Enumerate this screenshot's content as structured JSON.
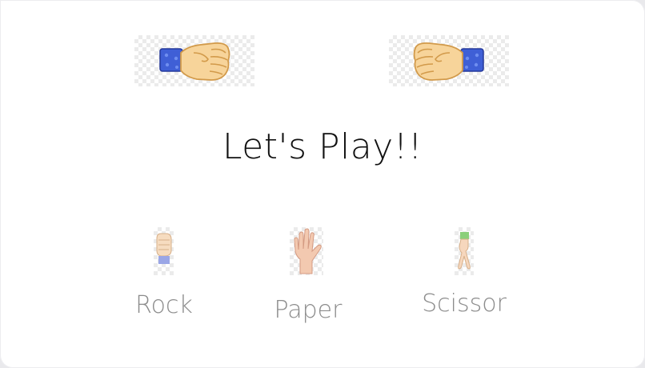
{
  "game": {
    "status_text": "Let's Play!!",
    "player_hand": "fist-icon",
    "computer_hand": "fist-icon"
  },
  "choices": [
    {
      "label": "Rock",
      "icon": "rock-hand-icon"
    },
    {
      "label": "Paper",
      "icon": "paper-hand-icon"
    },
    {
      "label": "Scissor",
      "icon": "scissor-hand-icon"
    }
  ],
  "colors": {
    "sleeve": "#3f5fd6",
    "skin": "#f7d49a",
    "skin_outline": "#d29a4a",
    "label": "#8c8c8c",
    "status": "#111111"
  }
}
